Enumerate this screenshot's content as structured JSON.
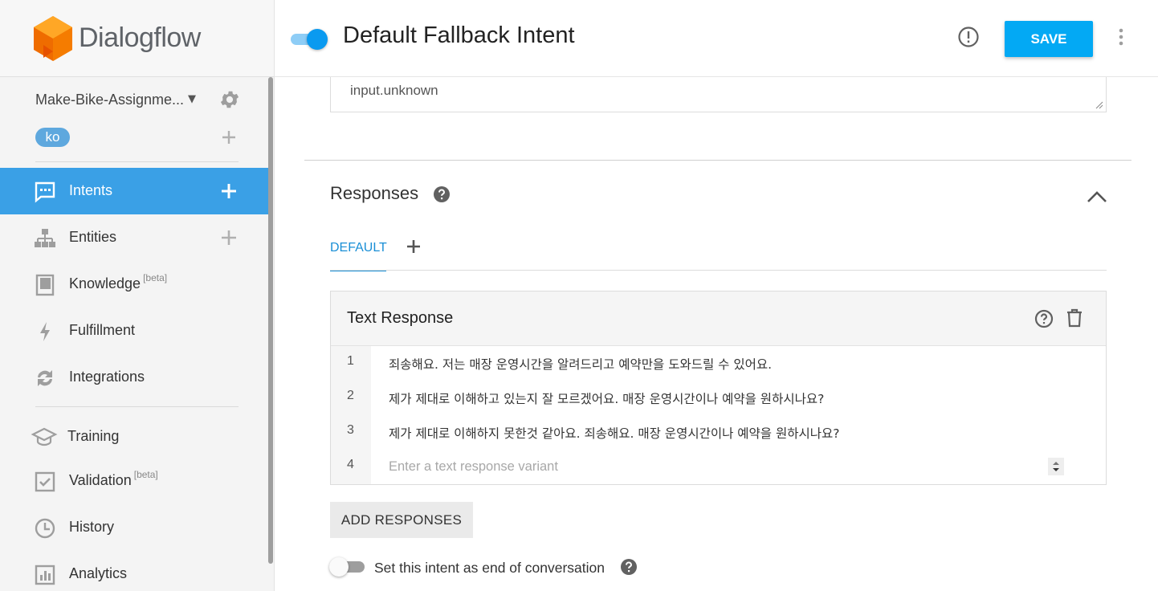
{
  "sidebar": {
    "brand": "Dialogflow",
    "agent_name": "Make-Bike-Assignme...",
    "language": "ko",
    "nav": {
      "intents": "Intents",
      "entities": "Entities",
      "knowledge": "Knowledge",
      "knowledge_badge": "[beta]",
      "fulfillment": "Fulfillment",
      "integrations": "Integrations",
      "training": "Training",
      "validation": "Validation",
      "validation_badge": "[beta]",
      "history": "History",
      "analytics": "Analytics"
    },
    "active_item": "Intents"
  },
  "header": {
    "intent_enabled": true,
    "title": "Default Fallback Intent",
    "save_label": "SAVE"
  },
  "action": {
    "value": "input.unknown"
  },
  "responses": {
    "title": "Responses",
    "tabs": [
      {
        "label": "DEFAULT",
        "active": true
      }
    ],
    "card_title": "Text Response",
    "rows": [
      {
        "num": "1",
        "text": "죄송해요. 저는 매장 운영시간을 알려드리고 예약만을 도와드릴 수 있어요."
      },
      {
        "num": "2",
        "text": "제가 제대로 이해하고 있는지 잘 모르겠어요. 매장 운영시간이나 예약을 원하시나요?"
      },
      {
        "num": "3",
        "text": "제가 제대로 이해하지 못한것 같아요. 죄송해요. 매장 운영시간이나 예약을 원하시나요?"
      }
    ],
    "new_row_num": "4",
    "placeholder": "Enter a text response variant",
    "add_button": "ADD RESPONSES",
    "end_conversation_label": "Set this intent as end of conversation",
    "end_conversation_enabled": false
  },
  "colors": {
    "accent": "#03a9f4",
    "active_nav": "#3aa0e6",
    "logo_orange": "#f57c00"
  }
}
